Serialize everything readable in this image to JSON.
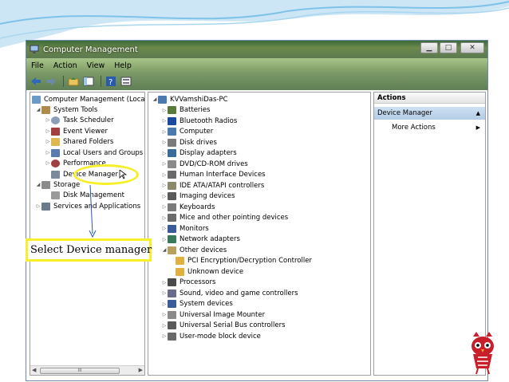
{
  "window": {
    "title": "Computer Management",
    "controls": [
      "minimize-icon",
      "maximize-icon",
      "close-icon"
    ]
  },
  "menubar": {
    "items": [
      "File",
      "Action",
      "View",
      "Help"
    ]
  },
  "toolbar": {
    "buttons": [
      "back-arrow-icon",
      "forward-arrow-icon",
      "up-folder-icon",
      "show-hide-tree-icon",
      "help-icon",
      "properties-icon"
    ]
  },
  "left_tree": {
    "root": "Computer Management (Local",
    "system_tools": "System Tools",
    "items": [
      "Task Scheduler",
      "Event Viewer",
      "Shared Folders",
      "Local Users and Groups",
      "Performance",
      "Device Manager"
    ],
    "storage": "Storage",
    "disk_mgmt": "Disk Management",
    "services": "Services and Applications",
    "scroll_thumb": "III"
  },
  "device_tree": {
    "root": "KVVamshiDas-PC",
    "categories": [
      {
        "label": "Batteries",
        "icon": "battery-icon",
        "color": "#5a7a3a"
      },
      {
        "label": "Bluetooth Radios",
        "icon": "bluetooth-icon",
        "color": "#1a4aa0"
      },
      {
        "label": "Computer",
        "icon": "computer-icon",
        "color": "#4a7ab0"
      },
      {
        "label": "Disk drives",
        "icon": "disk-drive-icon",
        "color": "#7a7a7a"
      },
      {
        "label": "Display adapters",
        "icon": "display-adapter-icon",
        "color": "#3a6a9a"
      },
      {
        "label": "DVD/CD-ROM drives",
        "icon": "dvd-drive-icon",
        "color": "#8a8a8a"
      },
      {
        "label": "Human Interface Devices",
        "icon": "hid-icon",
        "color": "#6a6a6a"
      },
      {
        "label": "IDE ATA/ATAPI controllers",
        "icon": "ide-controller-icon",
        "color": "#8a8a6a"
      },
      {
        "label": "Imaging devices",
        "icon": "camera-icon",
        "color": "#5a5a5a"
      },
      {
        "label": "Keyboards",
        "icon": "keyboard-icon",
        "color": "#7a7a7a"
      },
      {
        "label": "Mice and other pointing devices",
        "icon": "mouse-icon",
        "color": "#6a6a6a"
      },
      {
        "label": "Monitors",
        "icon": "monitor-icon",
        "color": "#3a5a9a"
      },
      {
        "label": "Network adapters",
        "icon": "network-adapter-icon",
        "color": "#3a7a5a"
      }
    ],
    "other_devices": "Other devices",
    "other_children": [
      "PCI Encryption/Decryption Controller",
      "Unknown device"
    ],
    "more_categories": [
      {
        "label": "Processors",
        "icon": "processor-icon",
        "color": "#4a4a4a"
      },
      {
        "label": "Sound, video and game controllers",
        "icon": "speaker-icon",
        "color": "#6a6a8a"
      },
      {
        "label": "System devices",
        "icon": "system-device-icon",
        "color": "#3a5a9a"
      },
      {
        "label": "Universal Image Mounter",
        "icon": "image-mounter-icon",
        "color": "#8a8a8a"
      },
      {
        "label": "Universal Serial Bus controllers",
        "icon": "usb-icon",
        "color": "#5a5a5a"
      },
      {
        "label": "User-mode block device",
        "icon": "block-device-icon",
        "color": "#6a6a6a"
      }
    ]
  },
  "actions": {
    "header": "Actions",
    "selected": "Device Manager",
    "more": "More Actions"
  },
  "annotation": {
    "callout": "Select Device manager",
    "highlight_color": "#f7ef2a"
  }
}
